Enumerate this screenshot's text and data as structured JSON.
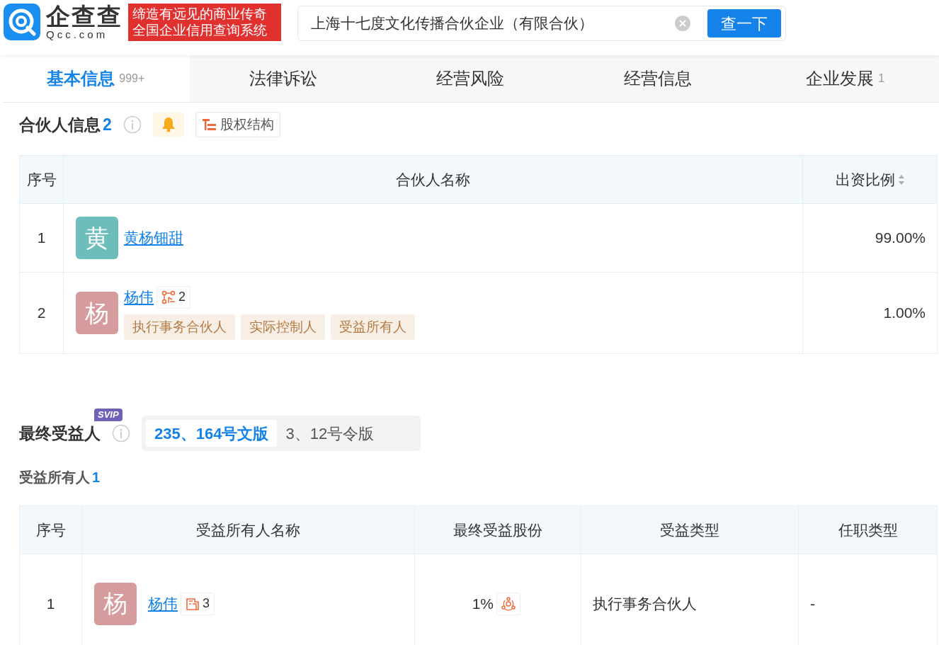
{
  "logo": {
    "name": "企查查",
    "domain": "Qcc.com"
  },
  "slogan": [
    "缔造有远见的商业传奇",
    "全国企业信用查询系统"
  ],
  "search": {
    "value": "上海十七度文化传播合伙企业（有限合伙）",
    "button": "查一下"
  },
  "tabs": [
    {
      "label": "基本信息",
      "count": "999+",
      "selected": true
    },
    {
      "label": "法律诉讼",
      "selected": false
    },
    {
      "label": "经营风险",
      "selected": false
    },
    {
      "label": "经营信息",
      "selected": false
    },
    {
      "label": "企业发展",
      "count": "1",
      "selected": false
    }
  ],
  "partners": {
    "title": "合伙人信息",
    "count": "2",
    "structure_button": "股权结构",
    "columns": [
      "序号",
      "合伙人名称",
      "出资比例"
    ],
    "rows": [
      {
        "index": "1",
        "avatar": "黄",
        "color": "#6dbdbb",
        "name": "黄杨钿甜",
        "ratio": "99.00%"
      },
      {
        "index": "2",
        "avatar": "杨",
        "color": "#d69b9c",
        "name": "杨伟",
        "related_count": "2",
        "tags": [
          "执行事务合伙人",
          "实际控制人",
          "受益所有人"
        ],
        "ratio": "1.00%"
      }
    ]
  },
  "beneficiaries": {
    "title": "最终受益人",
    "badge": "SVIP",
    "versions": [
      {
        "label": "235、164号文版",
        "selected": true
      },
      {
        "label": "3、12号令版",
        "selected": false
      }
    ],
    "subtitle": "受益所有人",
    "count": "1",
    "columns": [
      "序号",
      "受益所有人名称",
      "最终受益股份",
      "受益类型",
      "任职类型"
    ],
    "rows": [
      {
        "index": "1",
        "avatar": "杨",
        "color": "#d69b9c",
        "name": "杨伟",
        "company_count": "3",
        "share": "1%",
        "type": "执行事务合伙人",
        "position": "-"
      }
    ]
  }
}
